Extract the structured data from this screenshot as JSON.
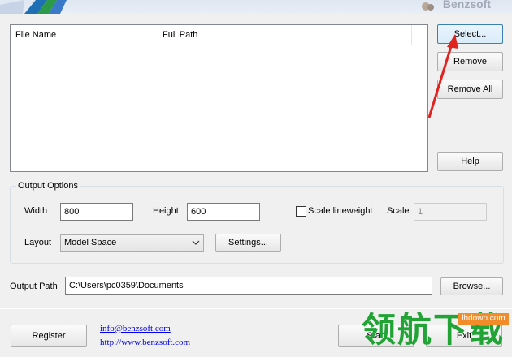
{
  "header": {
    "brand": "Benzsoft"
  },
  "file_list": {
    "columns": [
      "File Name",
      "Full Path"
    ],
    "rows": []
  },
  "side_buttons": {
    "select": "Select...",
    "remove": "Remove",
    "remove_all": "Remove All",
    "help": "Help"
  },
  "output_options": {
    "legend": "Output Options",
    "width_label": "Width",
    "width_value": "800",
    "height_label": "Height",
    "height_value": "600",
    "scale_lineweight_label": "Scale lineweight",
    "scale_lineweight_checked": false,
    "scale_label": "Scale",
    "scale_value": "1",
    "layout_label": "Layout",
    "layout_value": "Model Space",
    "settings_button": "Settings..."
  },
  "output_path": {
    "label": "Output Path",
    "value": "C:\\Users\\pc0359\\Documents",
    "browse_button": "Browse..."
  },
  "footer": {
    "register_button": "Register",
    "email_link": "info@benzsoft.com",
    "web_link": "http://www.benzsoft.com",
    "start_button": "Start",
    "exit_button": "Exit"
  },
  "watermark": {
    "text": "领航下载",
    "url": "lhdown.com"
  },
  "colors": {
    "arrow": "#e0231e",
    "watermark_green": "#21a336",
    "watermark_orange": "#f28c28"
  }
}
